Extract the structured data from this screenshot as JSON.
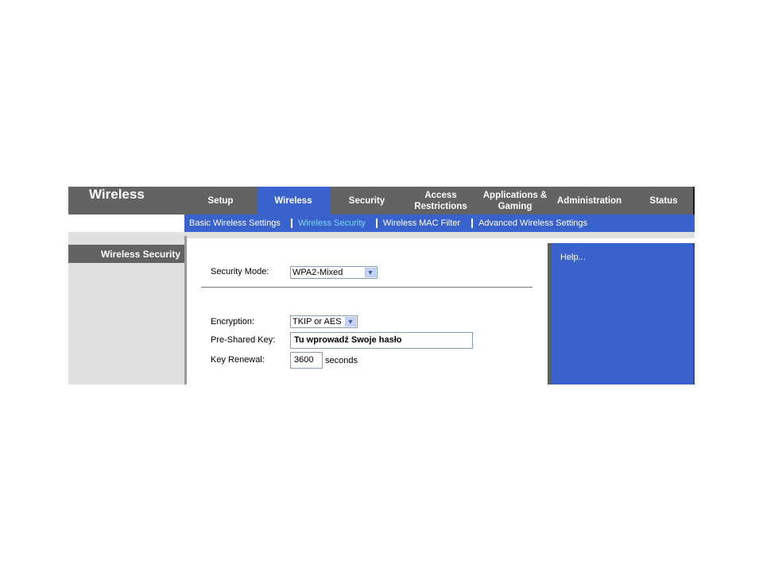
{
  "header": {
    "section_title": "Wireless",
    "tabs": [
      {
        "label": "Setup"
      },
      {
        "label": "Wireless"
      },
      {
        "label": "Security"
      },
      {
        "label": "Access Restrictions"
      },
      {
        "label": "Applications & Gaming"
      },
      {
        "label": "Administration"
      },
      {
        "label": "Status"
      }
    ],
    "active_tab": "Wireless"
  },
  "subnav": {
    "items": [
      {
        "label": "Basic Wireless Settings"
      },
      {
        "label": "Wireless Security"
      },
      {
        "label": "Wireless MAC Filter"
      },
      {
        "label": "Advanced Wireless Settings"
      }
    ],
    "active_item": "Wireless Security"
  },
  "sidebar": {
    "title": "Wireless Security"
  },
  "form": {
    "security_mode": {
      "label": "Security Mode:",
      "value": "WPA2-Mixed"
    },
    "encryption": {
      "label": "Encryption:",
      "value": "TKIP or AES"
    },
    "pre_shared_key": {
      "label": "Pre-Shared Key:",
      "value": "Tu wprowadź Swoje hasło"
    },
    "key_renewal": {
      "label": "Key Renewal:",
      "value": "3600",
      "unit": "seconds"
    }
  },
  "help": {
    "link": "Help..."
  },
  "colors": {
    "bar_grey": "#636363",
    "accent_blue": "#3a62cc",
    "active_subnav": "#7fd3ff"
  },
  "icons": {
    "dropdown": "chevron-down-icon"
  }
}
